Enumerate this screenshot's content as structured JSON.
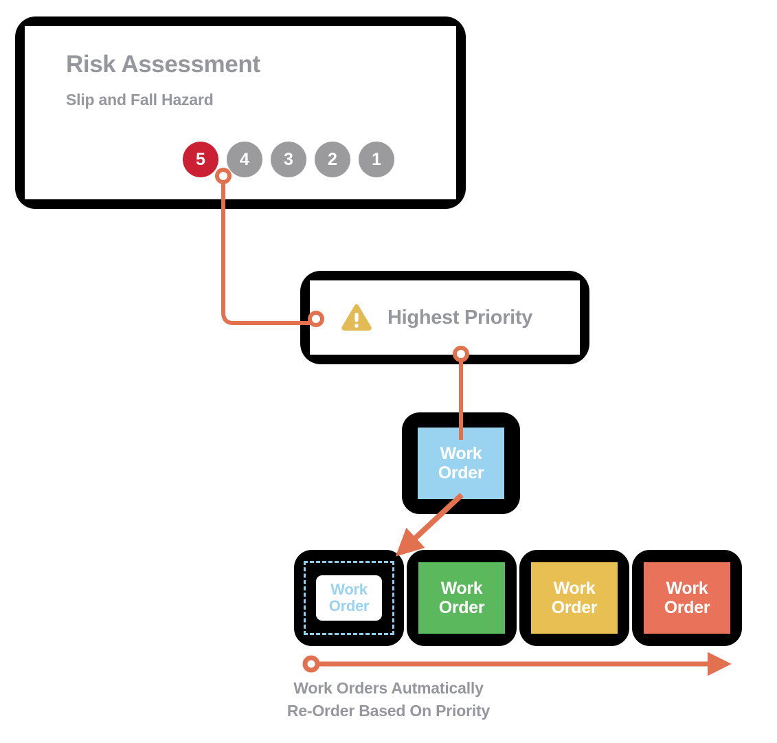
{
  "colors": {
    "accent_orange": "#e2714f",
    "frame_black": "#000000",
    "text_gray": "#96979c",
    "risk_selected_red": "#cb2033",
    "risk_inactive_gray": "#9b9b9e",
    "warning_amber": "#e3bb56",
    "work_order_blue": "#9ad3f0",
    "work_order_green": "#5cb85c",
    "work_order_yellow": "#e8bf52",
    "work_order_salmon": "#e8735a",
    "dropzone_dashed_blue": "#8ecdf0"
  },
  "risk_card": {
    "title": "Risk Assessment",
    "subtitle": "Slip and Fall Hazard",
    "rating_scale": [
      {
        "value": "5",
        "selected": true
      },
      {
        "value": "4",
        "selected": false
      },
      {
        "value": "3",
        "selected": false
      },
      {
        "value": "2",
        "selected": false
      },
      {
        "value": "1",
        "selected": false
      }
    ]
  },
  "priority_card": {
    "icon": "warning-triangle-icon",
    "label": "Highest Priority"
  },
  "floating_work_order": {
    "line1": "Work",
    "line2": "Order",
    "color": "blue"
  },
  "queue": {
    "slots": [
      {
        "line1": "Work",
        "line2": "Order",
        "color": "dropzone",
        "is_dropzone": true
      },
      {
        "line1": "Work",
        "line2": "Order",
        "color": "green",
        "is_dropzone": false
      },
      {
        "line1": "Work",
        "line2": "Order",
        "color": "yellow",
        "is_dropzone": false
      },
      {
        "line1": "Work",
        "line2": "Order",
        "color": "salmon",
        "is_dropzone": false
      }
    ]
  },
  "caption": {
    "line1": "Work Orders Autmatically",
    "line2": "Re-Order Based On Priority"
  },
  "connectors": [
    {
      "name": "risk-to-priority",
      "from": "rating-dot-5",
      "to": "priority-card-left",
      "style": "elbow-with-rings"
    },
    {
      "name": "priority-to-work-order",
      "from": "priority-card-bottom",
      "to": "floating-work-order",
      "style": "straight-with-ring"
    },
    {
      "name": "work-order-to-dropzone",
      "from": "floating-work-order",
      "to": "queue-slot-1",
      "style": "diagonal-arrow"
    },
    {
      "name": "priority-axis",
      "from": "queue-left",
      "to": "queue-right",
      "style": "ring-to-arrow"
    }
  ]
}
